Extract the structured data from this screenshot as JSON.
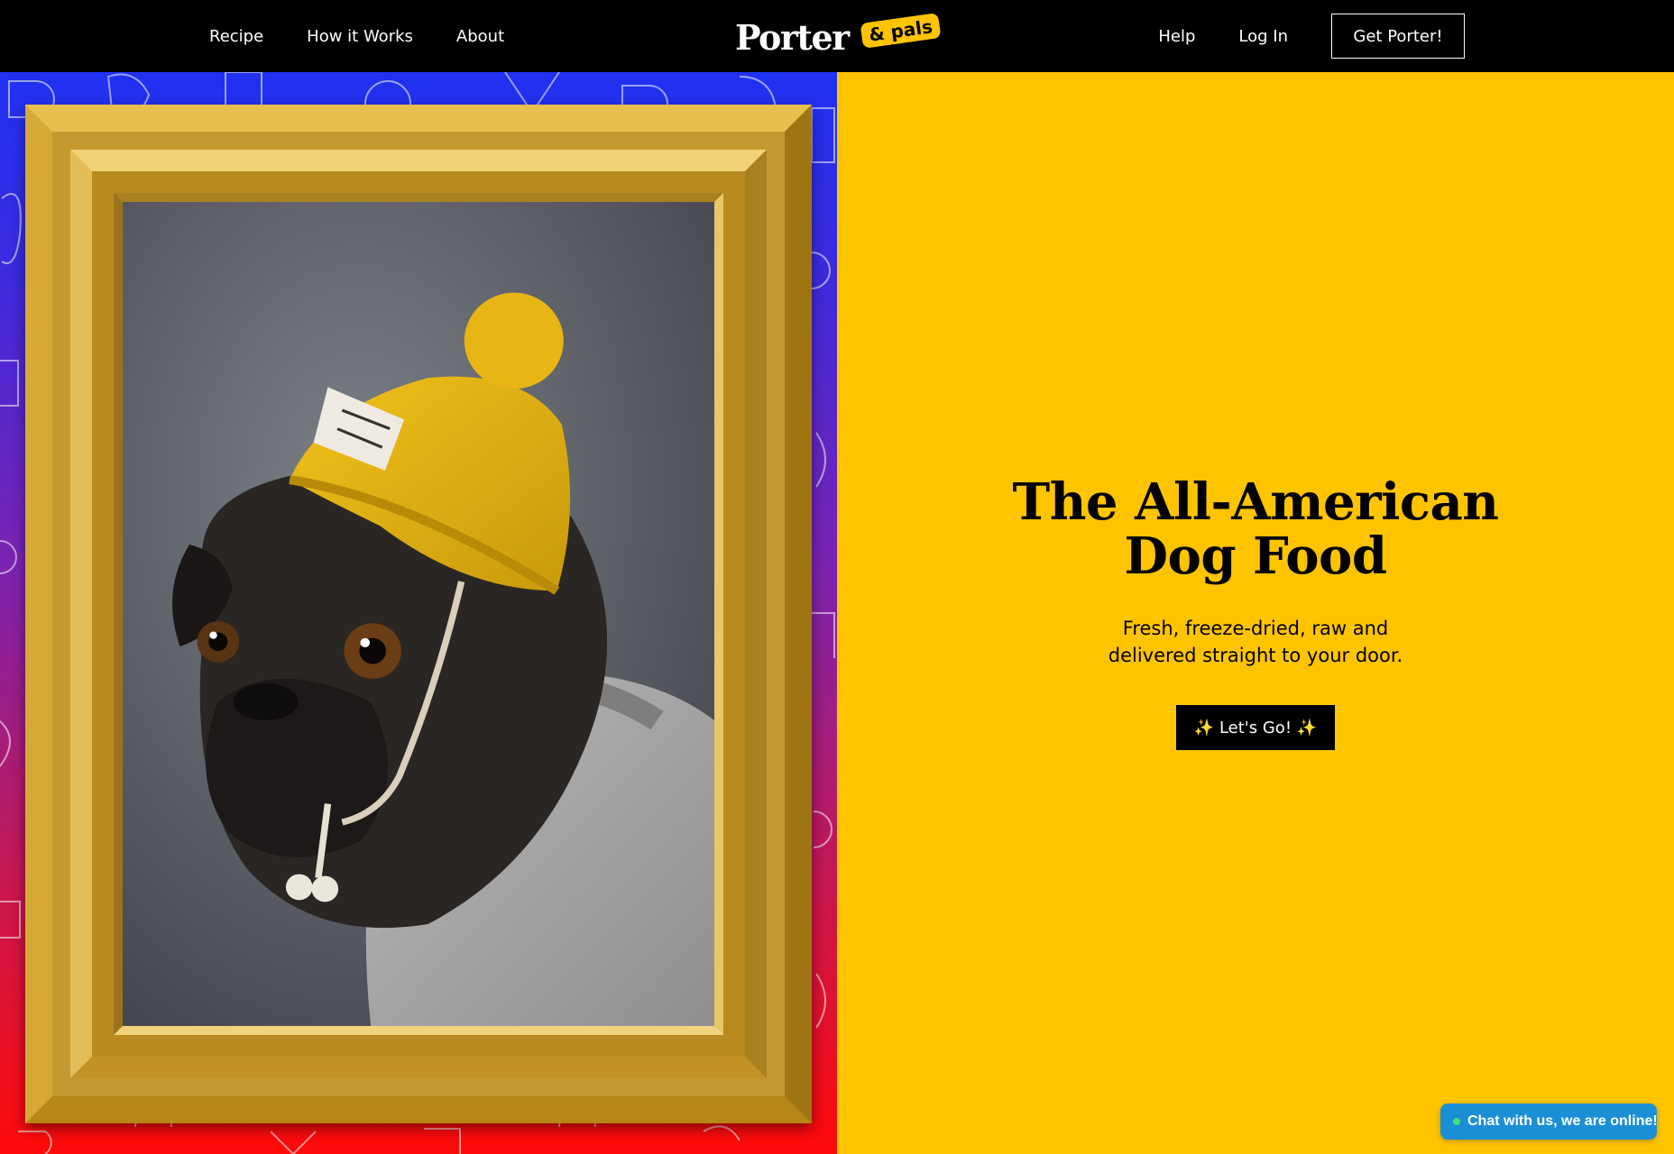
{
  "nav": {
    "left_links": [
      "Recipe",
      "How it Works",
      "About"
    ],
    "logo_main": "Porter",
    "logo_tag": "& pals",
    "right_links": [
      "Help",
      "Log In"
    ],
    "cta": "Get Porter!"
  },
  "hero": {
    "title_lines": [
      "The All-American",
      "Dog Food"
    ],
    "subtitle_lines": [
      "Fresh, freeze-dried, raw and",
      "delivered straight to your door."
    ],
    "cta": "✨ Let's Go! ✨"
  },
  "chat": {
    "label": "Chat with us, we are online!"
  },
  "colors": {
    "nav_bg": "#000000",
    "hero_bg": "#ffc400",
    "gradient_top": "#1f31f2",
    "gradient_bottom": "#ff0a08",
    "frame_gold": "#c99b26",
    "chat_bg": "#1b8fd6",
    "online_dot": "#3fe07a"
  }
}
